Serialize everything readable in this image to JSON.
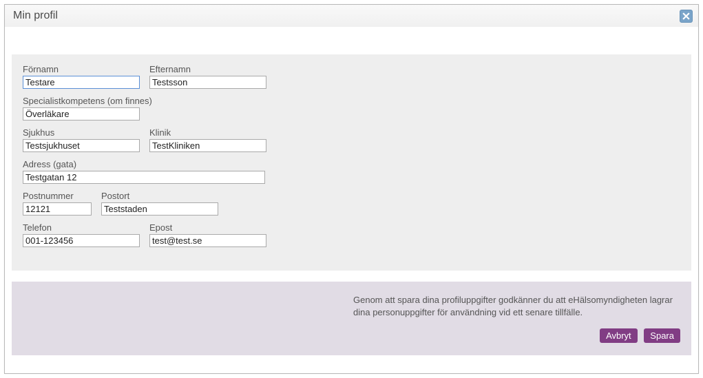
{
  "dialog": {
    "title": "Min profil"
  },
  "labels": {
    "fornamn": "Förnamn",
    "efternamn": "Efternamn",
    "specialist": "Specialistkompetens (om finnes)",
    "sjukhus": "Sjukhus",
    "klinik": "Klinik",
    "adress": "Adress (gata)",
    "postnr": "Postnummer",
    "postort": "Postort",
    "telefon": "Telefon",
    "epost": "Epost"
  },
  "values": {
    "fornamn": "Testare",
    "efternamn": "Testsson",
    "specialist": "Överläkare",
    "sjukhus": "Testsjukhuset",
    "klinik": "TestKliniken",
    "adress": "Testgatan 12",
    "postnr": "12121",
    "postort": "Teststaden",
    "telefon": "001-123456",
    "epost": "test@test.se"
  },
  "footer": {
    "consent": "Genom att spara dina profiluppgifter godkänner du att eHälsomyndigheten lagrar dina personuppgifter för användning vid ett senare tillfälle.",
    "cancel": "Avbryt",
    "save": "Spara"
  }
}
